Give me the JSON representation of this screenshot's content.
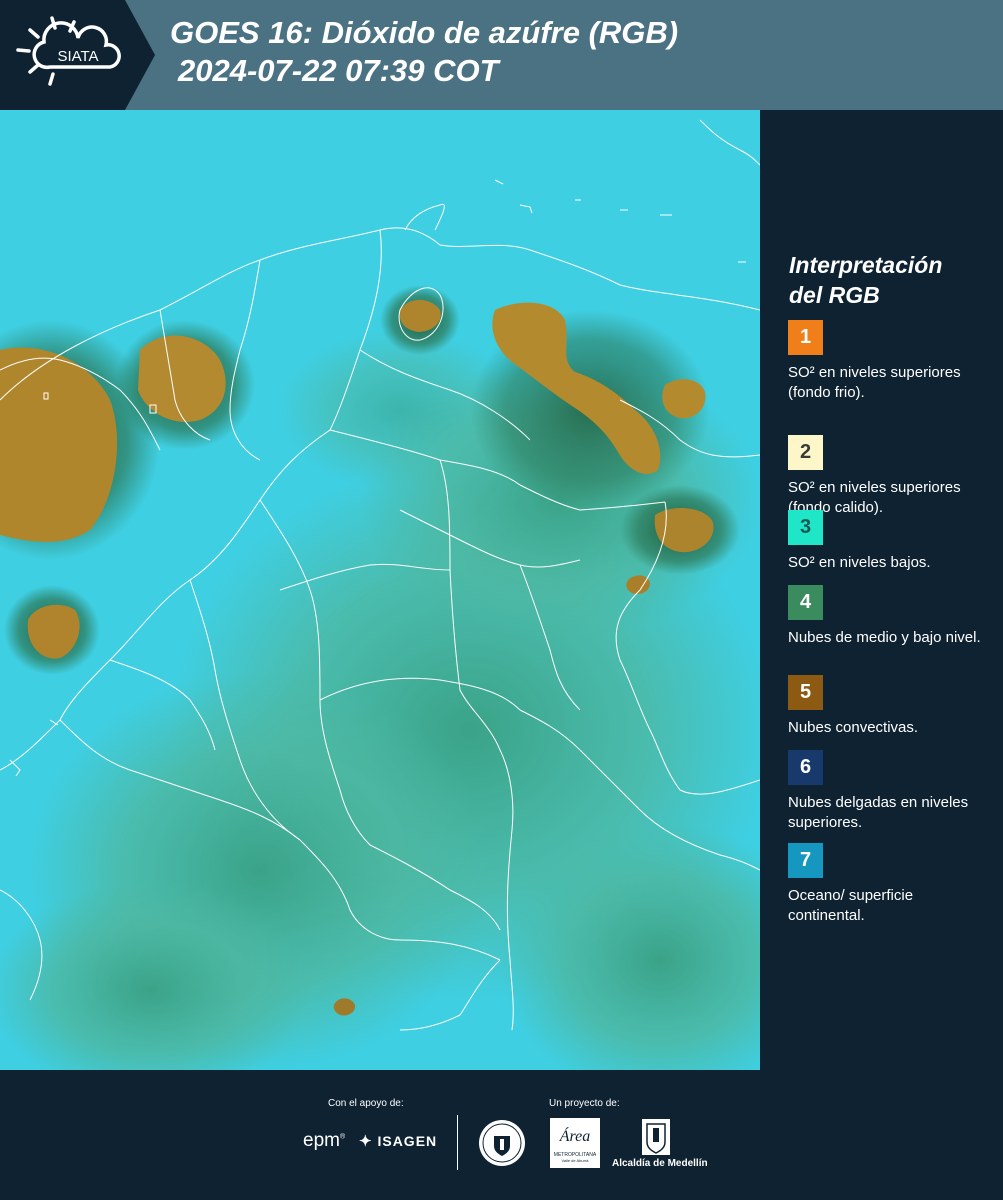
{
  "header": {
    "logo_text": "SIATA",
    "title_line1": "GOES 16: Dióxido de azúfre (RGB)",
    "title_line2": "2024-07-22 07:39 COT"
  },
  "legend": {
    "title_line1": "Interpretación",
    "title_line2": "del RGB",
    "items": [
      {
        "number": "1",
        "color": "#f07f1a",
        "text_color": "#ffffff",
        "label": "SO² en niveles superiores (fondo frio)."
      },
      {
        "number": "2",
        "color": "#fdf6c8",
        "text_color": "#3a3a3a",
        "label": "SO² en niveles superiores (fondo calido)."
      },
      {
        "number": "3",
        "color": "#20e6c8",
        "text_color": "#1a5a55",
        "label": "SO² en niveles bajos."
      },
      {
        "number": "4",
        "color": "#3a8c5e",
        "text_color": "#ffffff",
        "label": "Nubes de medio y bajo nivel."
      },
      {
        "number": "5",
        "color": "#8c5a12",
        "text_color": "#ffffff",
        "label": "Nubes convectivas."
      },
      {
        "number": "6",
        "color": "#17396b",
        "text_color": "#ffffff",
        "label": "Nubes delgadas en niveles superiores."
      },
      {
        "number": "7",
        "color": "#1597c0",
        "text_color": "#ffffff",
        "label": "Oceano/ superficie continental."
      }
    ]
  },
  "footer": {
    "support_label": "Con el apoyo de:",
    "project_label": "Un proyecto de:",
    "sponsor_epm": "epm",
    "sponsor_isagen": "ISAGEN",
    "area_metro": "Área",
    "area_metro_sub": "METROPOLITANA",
    "area_metro_sub2": "Valle de Aburrá",
    "alcaldia": "Alcaldía de Medellín"
  }
}
